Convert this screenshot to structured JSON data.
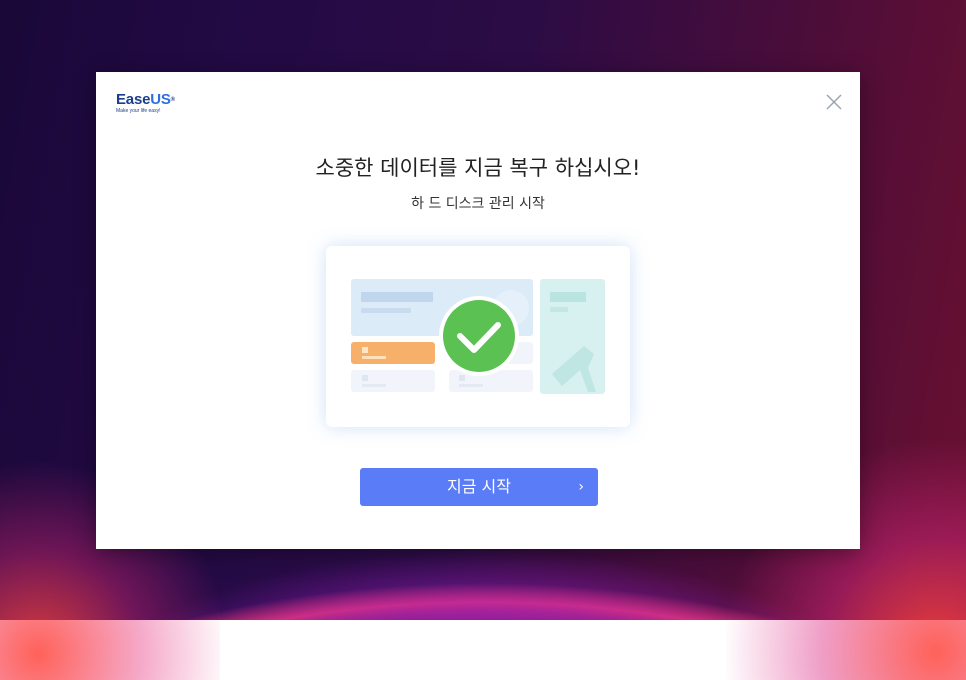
{
  "logo": {
    "name_part1": "Ease",
    "name_part2": "US",
    "registered": "®",
    "tagline": "Make your life easy!"
  },
  "dialog": {
    "title": "소중한 데이터를 지금 복구 하십시오!",
    "subtitle": "하 드 디스크 관리 시작",
    "start_button": "지금 시작",
    "start_arrow": "›"
  },
  "icons": {
    "close": "close-icon",
    "check": "checkmark-icon"
  },
  "colors": {
    "accent": "#5a7cf7",
    "check_green": "#5cc153",
    "brand_dark": "#1b3f8c",
    "brand_blue": "#2d6fe0"
  }
}
